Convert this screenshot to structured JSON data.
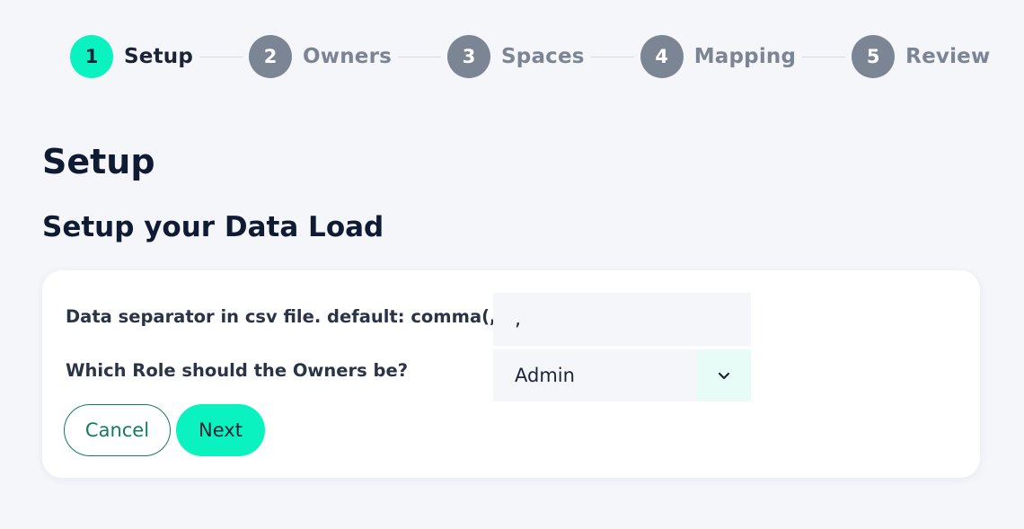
{
  "stepper": {
    "steps": [
      {
        "number": "1",
        "label": "Setup",
        "active": true
      },
      {
        "number": "2",
        "label": "Owners",
        "active": false
      },
      {
        "number": "3",
        "label": "Spaces",
        "active": false
      },
      {
        "number": "4",
        "label": "Mapping",
        "active": false
      },
      {
        "number": "5",
        "label": "Review",
        "active": false
      }
    ]
  },
  "page": {
    "title": "Setup",
    "subtitle": "Setup your Data Load"
  },
  "form": {
    "separator_label": "Data separator in csv file. default: comma(,) :",
    "separator_value": ",",
    "role_label": "Which Role should the Owners be?",
    "role_value": "Admin",
    "role_icon": "chevron-down-icon"
  },
  "buttons": {
    "cancel_label": "Cancel",
    "next_label": "Next"
  },
  "colors": {
    "accent": "#0af2c0",
    "inactive_step": "#7c8594",
    "cancel_border": "#137a63",
    "background": "#f4f6fa"
  }
}
